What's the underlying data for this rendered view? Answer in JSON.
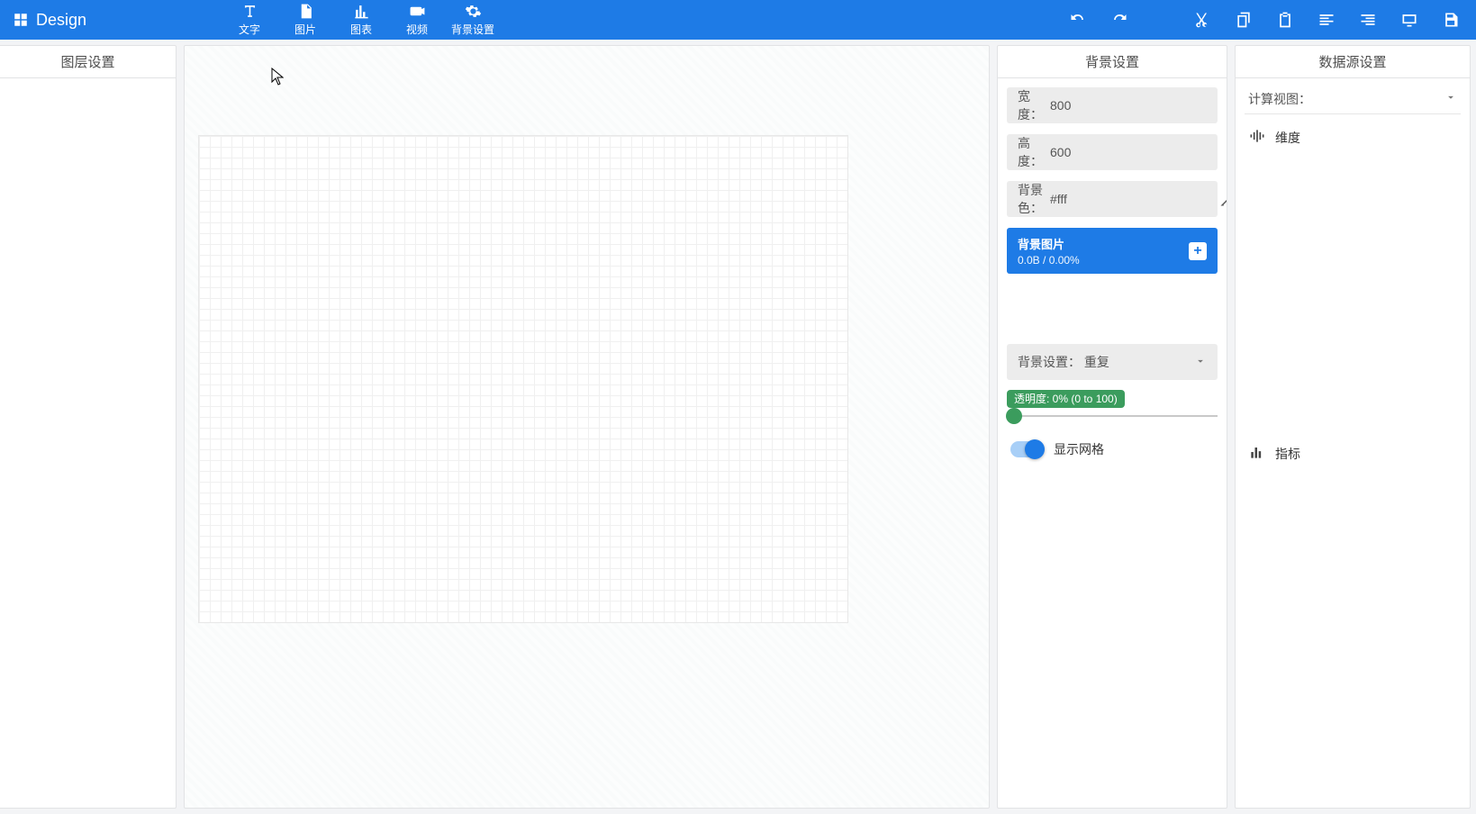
{
  "brand": {
    "title": "Design"
  },
  "toolbar": {
    "text": {
      "label": "文字"
    },
    "image": {
      "label": "图片"
    },
    "chart": {
      "label": "图表"
    },
    "video": {
      "label": "视频"
    },
    "bgset": {
      "label": "背景设置"
    }
  },
  "leftPanel": {
    "title": "图层设置"
  },
  "bgPanel": {
    "title": "背景设置",
    "widthLabel": "宽度：",
    "widthValue": "800",
    "heightLabel": "高度：",
    "heightValue": "600",
    "bgColorLabel": "背景色：",
    "bgColorValue": "#fff",
    "bgImage": {
      "title": "背景图片",
      "status": "0.0B / 0.00%"
    },
    "bgRepeat": {
      "label": "背景设置：",
      "value": "重复"
    },
    "opacityChip": "透明度: 0% (0 to 100)",
    "gridLabel": "显示网格"
  },
  "dataPanel": {
    "title": "数据源设置",
    "calcViewLabel": "计算视图：",
    "dimension": "维度",
    "metric": "指标"
  }
}
